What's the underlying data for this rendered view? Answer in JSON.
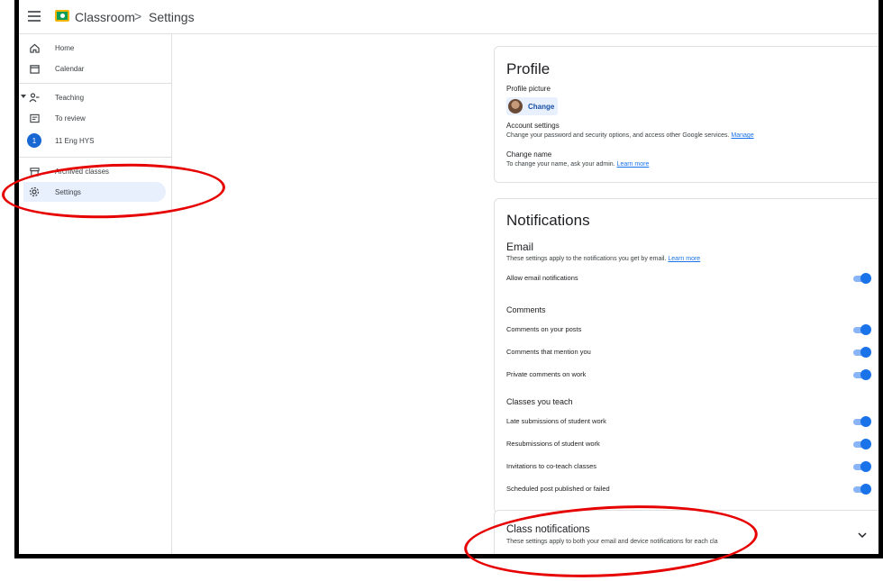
{
  "header": {
    "app_name": "Classroom",
    "separator": ">",
    "page": "Settings"
  },
  "sidebar": {
    "home": "Home",
    "calendar": "Calendar",
    "teaching": "Teaching",
    "to_review": "To review",
    "class_name": "11 Eng HYS",
    "class_initial": "1",
    "archived": "Archived classes",
    "settings": "Settings"
  },
  "profile": {
    "title": "Profile",
    "picture_label": "Profile picture",
    "change_button": "Change",
    "account_label": "Account settings",
    "account_desc": "Change your password and security options, and access other Google services.",
    "account_link": "Manage",
    "name_label": "Change name",
    "name_desc": "To change your name, ask your admin.",
    "name_link": "Learn more"
  },
  "notifications": {
    "title": "Notifications",
    "email_heading": "Email",
    "email_desc": "These settings apply to the notifications you get by email.",
    "email_link": "Learn more",
    "allow_email": "Allow email notifications",
    "comments_heading": "Comments",
    "comments": [
      "Comments on your posts",
      "Comments that mention you",
      "Private comments on work"
    ],
    "classes_heading": "Classes you teach",
    "classes": [
      "Late submissions of student work",
      "Resubmissions of student work",
      "Invitations to co-teach classes",
      "Scheduled post published or failed"
    ]
  },
  "class_notifications": {
    "title": "Class notifications",
    "desc": "These settings apply to both your email and device notifications for each cla"
  },
  "toggle_states": {
    "allow_email": true,
    "comments": [
      true,
      true,
      true
    ],
    "classes": [
      true,
      true,
      true,
      true
    ]
  },
  "colors": {
    "accent": "#1a73e8",
    "toggle_track": "#8ab4f8",
    "annotation": "#e60000",
    "active_nav": "#e8f0fe"
  },
  "icons": [
    "menu-icon",
    "classroom-logo",
    "home-icon",
    "calendar-icon",
    "teaching-icon",
    "to-review-icon",
    "archive-icon",
    "gear-icon",
    "chevron-down-icon"
  ]
}
